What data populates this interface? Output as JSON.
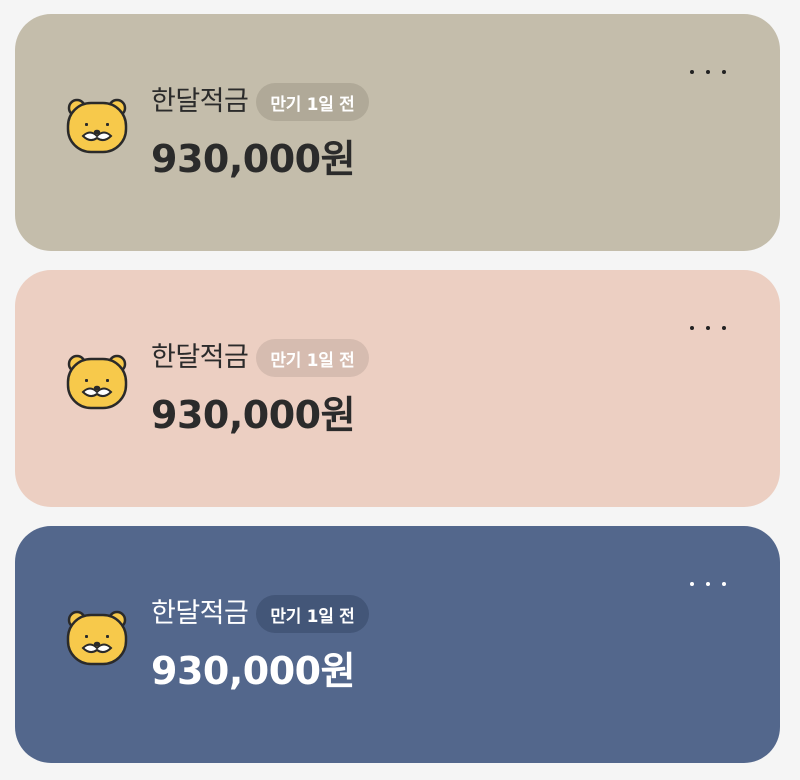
{
  "savings_list": {
    "items": [
      {
        "name": "한달적금",
        "badge": "만기 1일 전",
        "amount": "930,000원",
        "colors": {
          "background": "#c4bdab",
          "text": "#2b2b2b",
          "badge_bg": "#b0a998",
          "badge_text": "#ffffff",
          "menu_dot": "#222222"
        }
      },
      {
        "name": "한달적금",
        "badge": "만기 1일 전",
        "amount": "930,000원",
        "colors": {
          "background": "#eccfc2",
          "text": "#2b2b2b",
          "badge_bg": "#d6bcb0",
          "badge_text": "#ffffff",
          "menu_dot": "#222222"
        }
      },
      {
        "name": "한달적금",
        "badge": "만기 1일 전",
        "amount": "930,000원",
        "colors": {
          "background": "#53678c",
          "text": "#ffffff",
          "badge_bg": "#435678",
          "badge_text": "#ffffff",
          "menu_dot": "#ffffff"
        }
      }
    ],
    "avatar_icon": "ryan-character-icon",
    "menu_icon": "more-horizontal-icon"
  }
}
